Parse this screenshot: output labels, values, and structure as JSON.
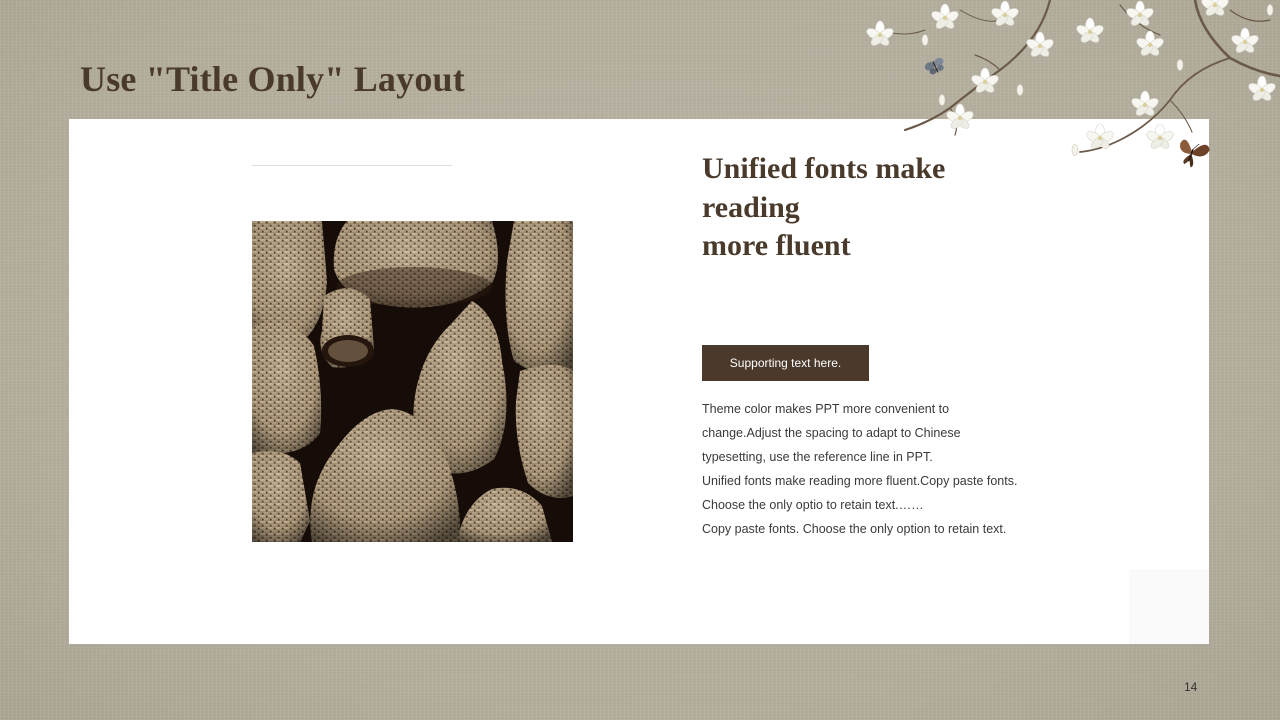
{
  "slide": {
    "title": "Use \"Title Only\" Layout",
    "page_number": "14"
  },
  "content": {
    "heading_lines": [
      "Unified fonts make",
      "reading",
      "more fluent"
    ],
    "support_label": "Supporting text here.",
    "body_lines": [
      "Theme  color makes PPT more convenient  to",
      "change.Adjust  the spacing  to adapt to Chinese",
      "typesetting, use  the reference line  in PPT.",
      "Unified  fonts make reading more fluent.Copy paste fonts.",
      "Choose the only  optio to retain text.……",
      "Copy paste  fonts. Choose the only option to retain text."
    ]
  },
  "colors": {
    "background": "#b7b1a1",
    "accent_brown": "#4b3a2c",
    "panel": "#ffffff",
    "body_text": "#3a3a3a"
  },
  "icons": {
    "decoration": "magnolia-branch-with-butterflies",
    "photo": "woven-bamboo-baskets-photo"
  }
}
